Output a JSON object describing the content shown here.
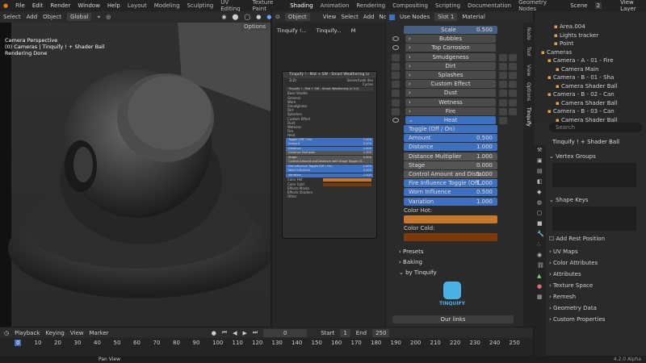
{
  "topbar": {
    "menus": [
      "File",
      "Edit",
      "Render",
      "Window",
      "Help"
    ],
    "workspaces": [
      "Layout",
      "Modeling",
      "Sculpting",
      "UV Editing",
      "Texture Paint",
      "Shading",
      "Animation",
      "Rendering",
      "Compositing",
      "Scripting",
      "Documentation",
      "Geometry Nodes"
    ],
    "active_workspace": "Shading",
    "scene": "Scene",
    "view_layer": "View Layer",
    "count": "2"
  },
  "viewport": {
    "menus": [
      "Select",
      "Add",
      "Object"
    ],
    "orientation": "Global",
    "overlay_lines": [
      "Camera Perspective",
      "(0) Cameras | Tinquify ! + Shader Ball",
      "Rendering Done"
    ],
    "options": "Options"
  },
  "node_editor": {
    "mode": "Object",
    "menus": [
      "View",
      "Select",
      "Add",
      "Node"
    ],
    "use_nodes": "Use Nodes",
    "slot": "Slot 1",
    "material_label": "Material",
    "breadcrumbs": [
      "Tinquify !...",
      "Tinquify...",
      "M"
    ],
    "node": {
      "title": "Tinquify ! - Mat + SW - Smart Weathering (v 3.2)",
      "output_labels": [
        "Server/Look dev",
        "Cycles"
      ],
      "sub_title": "Tinquify ! - Mat + SW - Smart Weathering (v 3.2)",
      "rows": [
        "Base Shader",
        "General",
        "Worn",
        "Smudginess",
        "Dirt",
        "Splashes",
        "Custom Effect",
        "Dust",
        "Wetness",
        "Fire",
        "Heat"
      ],
      "fields": [
        {
          "label": "Toggle (Off / On)",
          "value": "1.000",
          "blue": true
        },
        {
          "label": "Amount",
          "value": "0.500",
          "blue": true
        },
        {
          "label": "Distance",
          "value": "1.000",
          "blue": true
        },
        {
          "label": "Distance Multiplier",
          "value": "1.000",
          "blue": false
        },
        {
          "label": "Stage",
          "value": "0.000",
          "blue": false
        },
        {
          "label": "Control Amount and Distance with Stage Toggle (O...",
          "value": "",
          "blue": false
        },
        {
          "label": "Fire Influence Toggle (Off / On)",
          "value": "1.000",
          "blue": true
        },
        {
          "label": "Worn Influence",
          "value": "0.500",
          "blue": true
        },
        {
          "label": "Variation",
          "value": "1.000",
          "blue": true
        }
      ],
      "color_labels": [
        "Color Hot",
        "Color Cold"
      ],
      "bottom_rows": [
        "Effects Masks",
        "Effects Shaders",
        "Other"
      ]
    }
  },
  "n_panel": {
    "tabs": [
      "Node",
      "Tool",
      "View",
      "Options",
      "Tinquify"
    ],
    "scale": {
      "label": "Scale",
      "value": "0.500"
    },
    "sections": [
      "Bubbles",
      "Top Corrosion",
      "Smudgeness",
      "Dirt",
      "Splashes",
      "Custom Effect",
      "Dust",
      "Wetness",
      "Fire"
    ],
    "heat_label": "Heat",
    "heat_fields": [
      {
        "label": "Toggle (Off / On)",
        "value": "",
        "blue": true
      },
      {
        "label": "Amount",
        "value": "0.500",
        "blue": true
      },
      {
        "label": "Distance",
        "value": "1.000",
        "blue": true
      },
      {
        "label": "Distance Multiplier",
        "value": "1.000",
        "blue": false
      },
      {
        "label": "Stage",
        "value": "0.000",
        "blue": false
      },
      {
        "label": "Control Amount and Dista...",
        "value": "1.000",
        "blue": false
      },
      {
        "label": "Fire Influence Toggle (Off...",
        "value": "1.000",
        "blue": true
      },
      {
        "label": "Worn Influence",
        "value": "0.500",
        "blue": true
      },
      {
        "label": "Variation",
        "value": "1.000",
        "blue": true
      }
    ],
    "color_hot": "Color Hot:",
    "color_cold": "Color Cold:",
    "collapsed": [
      "Presets",
      "Baking",
      "by Tinquify"
    ],
    "logo_text": "TINQUIFY",
    "our_links": "Our links"
  },
  "outliner": {
    "rows": [
      {
        "label": "Area.004",
        "indent": 20
      },
      {
        "label": "Lights tracker",
        "indent": 20
      },
      {
        "label": "Point",
        "indent": 20
      },
      {
        "label": "Cameras",
        "indent": 4
      },
      {
        "label": "Camera - A - 01 - Fire",
        "indent": 12
      },
      {
        "label": "Camera Main",
        "indent": 22
      },
      {
        "label": "Camera - B - 01 - Sha",
        "indent": 12
      },
      {
        "label": "Camera Shader Ball",
        "indent": 22
      },
      {
        "label": "Camera - B - 02 - Can",
        "indent": 12
      },
      {
        "label": "Camera Shader Ball",
        "indent": 22
      },
      {
        "label": "Camera - B - 03 - Can",
        "indent": 12
      },
      {
        "label": "Camera Shader Ball",
        "indent": 22
      }
    ]
  },
  "properties": {
    "search_placeholder": "Search",
    "object_name": "Tinquify ! + Shader Ball",
    "sections_top": [
      "Vertex Groups",
      "Shape Keys"
    ],
    "add_rest": "Add Rest Position",
    "sections": [
      "UV Maps",
      "Color Attributes",
      "Attributes",
      "Texture Space",
      "Remesh",
      "Geometry Data",
      "Custom Properties"
    ]
  },
  "timeline": {
    "menus": [
      "Playback",
      "Keying",
      "View",
      "Marker"
    ],
    "current_frame": "0",
    "start_label": "Start",
    "start": "1",
    "end_label": "End",
    "end": "250",
    "ticks": [
      "0",
      "10",
      "20",
      "30",
      "40",
      "50",
      "60",
      "70",
      "80",
      "90",
      "100",
      "110",
      "120",
      "130",
      "140",
      "150",
      "160",
      "170",
      "180",
      "190",
      "200",
      "210",
      "220",
      "230",
      "240",
      "250"
    ]
  },
  "status": {
    "hint": "Pan View",
    "version": "4.2.0 Alpha"
  }
}
